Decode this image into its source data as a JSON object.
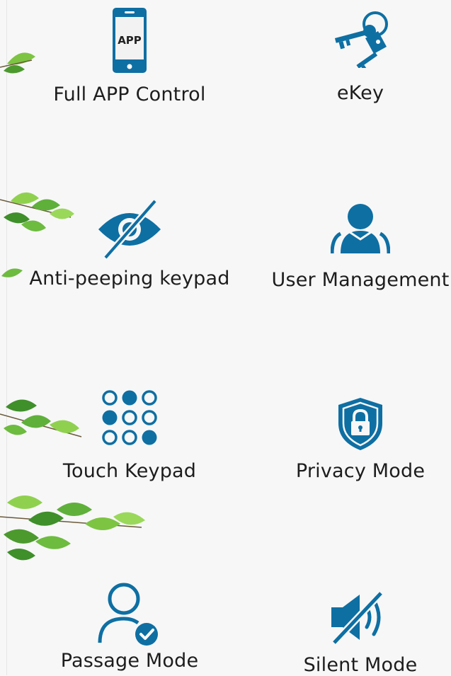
{
  "colors": {
    "icon": "#0e6fa3",
    "text": "#1d1d1d",
    "background": "#f7f7f7",
    "leaf_light": "#8fd14f",
    "leaf_dark": "#3f8f2a"
  },
  "features": [
    {
      "label": "Full APP Control",
      "icon": "smartphone-app-icon",
      "icon_text": "APP"
    },
    {
      "label": "eKey",
      "icon": "keys-icon"
    },
    {
      "label": "Anti-peeping keypad",
      "icon": "eye-slash-icon"
    },
    {
      "label": "User Management",
      "icon": "users-icon"
    },
    {
      "label": "Touch Keypad",
      "icon": "keypad-dots-icon"
    },
    {
      "label": "Privacy Mode",
      "icon": "shield-lock-icon"
    },
    {
      "label": "Passage Mode",
      "icon": "user-check-icon"
    },
    {
      "label": "Silent Mode",
      "icon": "speaker-mute-icon"
    }
  ]
}
